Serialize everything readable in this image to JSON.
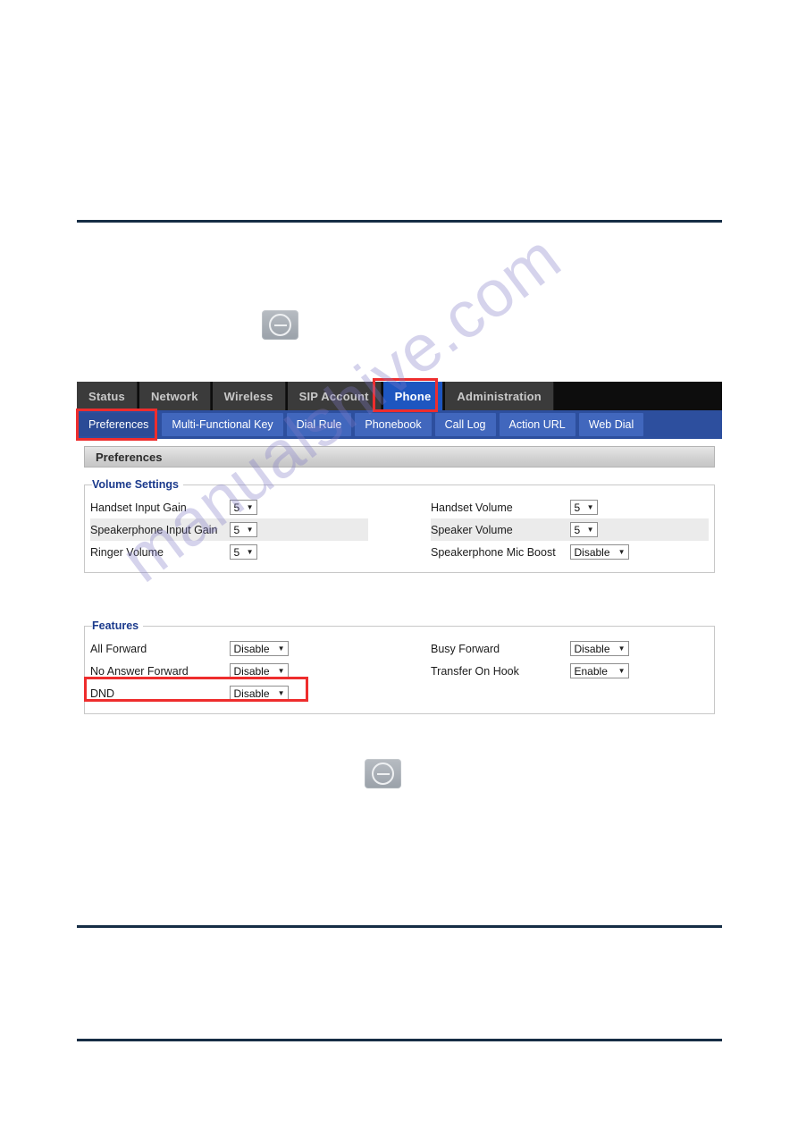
{
  "watermark": {
    "text": "manualshive.com"
  },
  "glyph_buttons": {
    "icon_name": "dnd-minus-circle-icon",
    "top_label": "DND key",
    "bottom_label": "DND key"
  },
  "web_ui": {
    "main_tabs": [
      {
        "label": "Status",
        "active": false
      },
      {
        "label": "Network",
        "active": false
      },
      {
        "label": "Wireless",
        "active": false
      },
      {
        "label": "SIP Account",
        "active": false
      },
      {
        "label": "Phone",
        "active": true
      },
      {
        "label": "Administration",
        "active": false
      }
    ],
    "sub_tabs": [
      {
        "label": "Preferences",
        "active": true
      },
      {
        "label": "Multi-Functional Key",
        "active": false
      },
      {
        "label": "Dial Rule",
        "active": false
      },
      {
        "label": "Phonebook",
        "active": false
      },
      {
        "label": "Call Log",
        "active": false
      },
      {
        "label": "Action URL",
        "active": false
      },
      {
        "label": "Web Dial",
        "active": false
      }
    ],
    "section_title": "Preferences",
    "groups": [
      {
        "legend": "Volume Settings",
        "rows": [
          {
            "left": {
              "label": "Handset Input Gain",
              "value": "5",
              "width": "small"
            },
            "right": {
              "label": "Handset Volume",
              "value": "5",
              "width": "small"
            }
          },
          {
            "left": {
              "label": "Speakerphone Input Gain",
              "value": "5",
              "width": "small"
            },
            "right": {
              "label": "Speaker Volume",
              "value": "5",
              "width": "small"
            }
          },
          {
            "left": {
              "label": "Ringer Volume",
              "value": "5",
              "width": "small"
            },
            "right": {
              "label": "Speakerphone Mic Boost",
              "value": "Disable",
              "width": "wide"
            }
          }
        ]
      },
      {
        "legend": "Features",
        "rows": [
          {
            "left": {
              "label": "All Forward",
              "value": "Disable",
              "width": "wide"
            },
            "right": {
              "label": "Busy Forward",
              "value": "Disable",
              "width": "wide"
            }
          },
          {
            "left": {
              "label": "No Answer Forward",
              "value": "Disable",
              "width": "wide"
            },
            "right": {
              "label": "Transfer On Hook",
              "value": "Enable",
              "width": "wide"
            }
          },
          {
            "left": {
              "label": "DND",
              "value": "Disable",
              "width": "wide"
            },
            "right": {
              "label": "",
              "value": "",
              "width": "wide"
            }
          }
        ]
      }
    ]
  },
  "colors": {
    "rule": "#162d45",
    "highlight": "#ee2d2d",
    "active_tab": "#1e56c0",
    "subtab_bar": "#2d4f9e",
    "legend": "#1b3a8c"
  }
}
